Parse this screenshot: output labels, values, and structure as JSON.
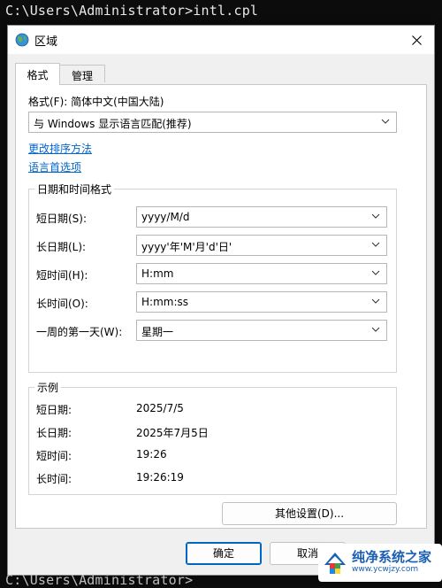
{
  "console": {
    "top_line": "C:\\Users\\Administrator>intl.cpl",
    "bottom_line": "C:\\Users\\Administrator>"
  },
  "dialog": {
    "title": "区域",
    "tabs": [
      {
        "label": "格式"
      },
      {
        "label": "管理"
      }
    ],
    "format_label": "格式(F): 简体中文(中国大陆)",
    "format_value": "与 Windows 显示语言匹配(推荐)",
    "links": {
      "sort": "更改排序方法",
      "lang": "语言首选项"
    },
    "datetime_group": "日期和时间格式",
    "fields": [
      {
        "label": "短日期(S):",
        "value": "yyyy/M/d"
      },
      {
        "label": "长日期(L):",
        "value": "yyyy'年'M'月'd'日'"
      },
      {
        "label": "短时间(H):",
        "value": "H:mm"
      },
      {
        "label": "长时间(O):",
        "value": "H:mm:ss"
      },
      {
        "label": "一周的第一天(W):",
        "value": "星期一"
      }
    ],
    "example_group": "示例",
    "examples": [
      {
        "label": "短日期:",
        "value": "2025/7/5"
      },
      {
        "label": "长日期:",
        "value": "2025年7月5日"
      },
      {
        "label": "短时间:",
        "value": "19:26"
      },
      {
        "label": "长时间:",
        "value": "19:26:19"
      }
    ],
    "buttons": {
      "other": "其他设置(D)...",
      "ok": "确定",
      "cancel": "取消"
    }
  },
  "watermark": {
    "text": "纯净系统之家",
    "url": "www.ycwjzy.com"
  },
  "colors": {
    "link": "#0066cc",
    "accent": "#0067c0"
  }
}
